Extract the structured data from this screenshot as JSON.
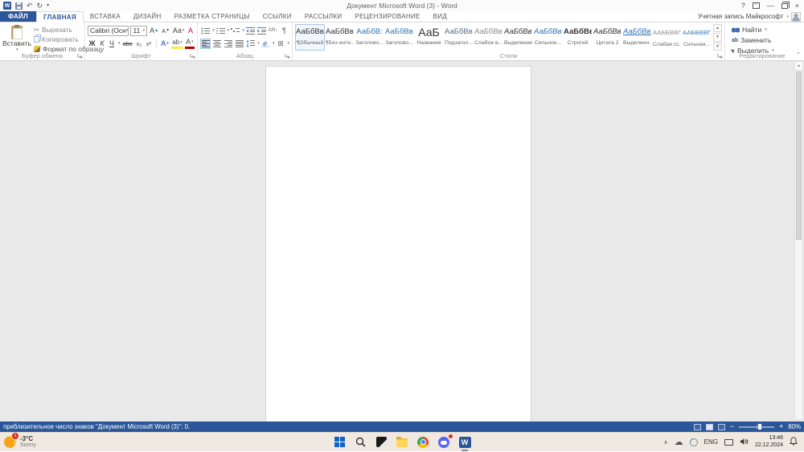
{
  "colors": {
    "accent": "#2B579A",
    "status_bar": "#2B579A",
    "heading_blue": "#2E74B5",
    "highlight_yellow": "#FFE94A",
    "font_color_red": "#C00000",
    "taskbar_bg": "#EFE9E1",
    "doc_bg": "#E9E9E9"
  },
  "title_bar": {
    "title": "Документ Microsoft Word (3) - Word",
    "word_logo": "W",
    "help": "?",
    "minimize": "—",
    "close": "×",
    "undo": "↶",
    "redo": "↻",
    "qat_more": "▾"
  },
  "tabs": {
    "file": "ФАЙЛ",
    "items": [
      "ГЛАВНАЯ",
      "ВСТАВКА",
      "ДИЗАЙН",
      "РАЗМЕТКА СТРАНИЦЫ",
      "ССЫЛКИ",
      "РАССЫЛКИ",
      "РЕЦЕНЗИРОВАНИЕ",
      "ВИД"
    ],
    "active": "ГЛАВНАЯ",
    "account_label": "Учетная запись Майкрософт",
    "account_caret": "▾"
  },
  "ribbon": {
    "clipboard": {
      "label": "Буфер обмена",
      "paste": "Вставить",
      "paste_caret": "▾",
      "cut": "Вырезать",
      "copy": "Копировать",
      "format_painter": "Формат по образцу"
    },
    "font": {
      "label": "Шрифт",
      "font_name": "Calibri (Осн",
      "font_size": "11",
      "grow": "А",
      "shrink": "А",
      "change_case": "Аа",
      "clear_format": "А",
      "bold": "Ж",
      "italic": "К",
      "underline": "Ч",
      "strikethrough": "abc",
      "subscript": "х₂",
      "superscript": "х²",
      "text_effects": "А",
      "highlight": "ab",
      "font_color": "А"
    },
    "paragraph": {
      "label": "Абзац",
      "sort": "АЯ",
      "sort_arrow": "↓",
      "pilcrow": "¶",
      "borders": "⊞"
    },
    "styles": {
      "label": "Стили",
      "items": [
        {
          "sample": "АаБбВвГг,",
          "label": "¶Обычный"
        },
        {
          "sample": "АаБбВвГг,",
          "label": "¶Без инте..."
        },
        {
          "sample": "АаБбВ:",
          "label": "Заголово..."
        },
        {
          "sample": "АаБбВвГ",
          "label": "Заголово..."
        },
        {
          "sample": "АаБ",
          "label": "Название"
        },
        {
          "sample": "АаБбВвГ",
          "label": "Подзагол..."
        },
        {
          "sample": "АаБбВвГв",
          "label": "Слабое в..."
        },
        {
          "sample": "АаБбВвГг",
          "label": "Выделение"
        },
        {
          "sample": "АаБбВвГг",
          "label": "Сильное..."
        },
        {
          "sample": "АаБбВвГг",
          "label": "Строгий"
        },
        {
          "sample": "АаБбВвГг",
          "label": "Цитата 2"
        },
        {
          "sample": "АаБбВвГг",
          "label": "Выделенн..."
        },
        {
          "sample": "АаБбВвГг,",
          "label": "Слабая сс..."
        },
        {
          "sample": "АаБбВвГг,",
          "label": "Сильная..."
        }
      ],
      "scroll_up": "▲",
      "scroll_down": "▼",
      "more": "▼"
    },
    "editing": {
      "label": "Редактирование",
      "find": "Найти",
      "find_caret": "▾",
      "replace": "Заменить",
      "replace_icon": "ab",
      "select": "Выделить",
      "select_caret": "▾"
    },
    "collapse_arrow": "⌃"
  },
  "status_bar": {
    "left_text": "приблизительное число знаков \"Документ Microsoft Word (3)\": 0.",
    "zoom_minus": "−",
    "zoom_plus": "+",
    "zoom_level": "80%"
  },
  "taskbar": {
    "weather": {
      "badge": "1",
      "temp": "-3°C",
      "condition": "Sunny"
    },
    "word_icon_letter": "W",
    "tray": {
      "hidden_icons": "∧",
      "cloud": "☁",
      "language": "ENG",
      "time": "13:46",
      "date": "22.12.2024"
    }
  }
}
